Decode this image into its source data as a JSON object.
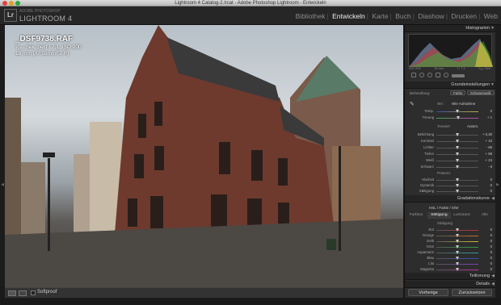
{
  "window": {
    "title": "Lightroom 4 Catalog-2.lrcat - Adobe Photoshop Lightroom - Entwickeln"
  },
  "header": {
    "logo": "Lr",
    "brand_small": "ADOBE PHOTOSHOP",
    "brand": "LIGHTROOM 4",
    "modules": [
      "Bibliothek",
      "Entwickeln",
      "Karte",
      "Buch",
      "Diashow",
      "Drucken",
      "Web"
    ],
    "active_module": "Entwickeln"
  },
  "photo": {
    "filename": "_DSF9738.RAF",
    "line1": "¹⁄₁₆₀ Sek. bei f / 7,1, ISO 200",
    "line2": "18 mm (XF18mmF2 R)"
  },
  "toolbar": {
    "softproof_label": "Softproof"
  },
  "panel": {
    "histogram_title": "Histogramm",
    "histogram_info_left": "ISO 200",
    "histogram_info_mid1": "18 mm",
    "histogram_info_mid2": "f / 7,1",
    "histogram_info_right": "¹⁄₁₆₀ Sek.",
    "basic_title": "Grundeinstellungen",
    "treatment_label": "Behandlung:",
    "treatment_color": "Farbe",
    "treatment_bw": "Schwarzweiß",
    "wb_label": "WA :",
    "wb_value": "Wie Aufnahme",
    "temp_label": "Temp.",
    "temp_value": "0",
    "tint_label": "Tönung",
    "tint_value": "+ 1",
    "tone_label": "Tonwert",
    "tone_auto": "Autom.",
    "sliders": [
      {
        "label": "Belichtung",
        "value": "+ 0,30"
      },
      {
        "label": "Kontrast",
        "value": "+ 10"
      },
      {
        "label": "Lichter",
        "value": "- 66"
      },
      {
        "label": "Tiefen",
        "value": "+ 58"
      },
      {
        "label": "Weiß",
        "value": "+ 24"
      },
      {
        "label": "Schwarz",
        "value": "- 8"
      }
    ],
    "presence_label": "Präsenz",
    "presence_sliders": [
      {
        "label": "Klarheit",
        "value": "0"
      },
      {
        "label": "Dynamik",
        "value": "0"
      },
      {
        "label": "Sättigung",
        "value": "0"
      }
    ],
    "tone_curve_title": "Gradationskurve",
    "hsl_tabs": [
      "HSL",
      "Farbe",
      "S/W"
    ],
    "hsl_subtabs": [
      "Farbton",
      "Sättigung",
      "Luminanz",
      "Alle"
    ],
    "hsl_active": "Sättigung",
    "hsl_section": "Sättigung",
    "hsl_colors": [
      {
        "label": "Rot",
        "value": "0",
        "color": "#c03030"
      },
      {
        "label": "Orange",
        "value": "0",
        "color": "#d07020"
      },
      {
        "label": "Gelb",
        "value": "0",
        "color": "#c8c030"
      },
      {
        "label": "Grün",
        "value": "0",
        "color": "#30a040"
      },
      {
        "label": "Aquamarin",
        "value": "0",
        "color": "#30a0a0"
      },
      {
        "label": "Blau",
        "value": "0",
        "color": "#3050c0"
      },
      {
        "label": "Lila",
        "value": "0",
        "color": "#8040c0"
      },
      {
        "label": "Magenta",
        "value": "0",
        "color": "#c030a0"
      }
    ],
    "split_title": "Teiltonung",
    "detail_title": "Details",
    "prev_button": "Vorherige",
    "reset_button": "Zurücksetzen"
  }
}
